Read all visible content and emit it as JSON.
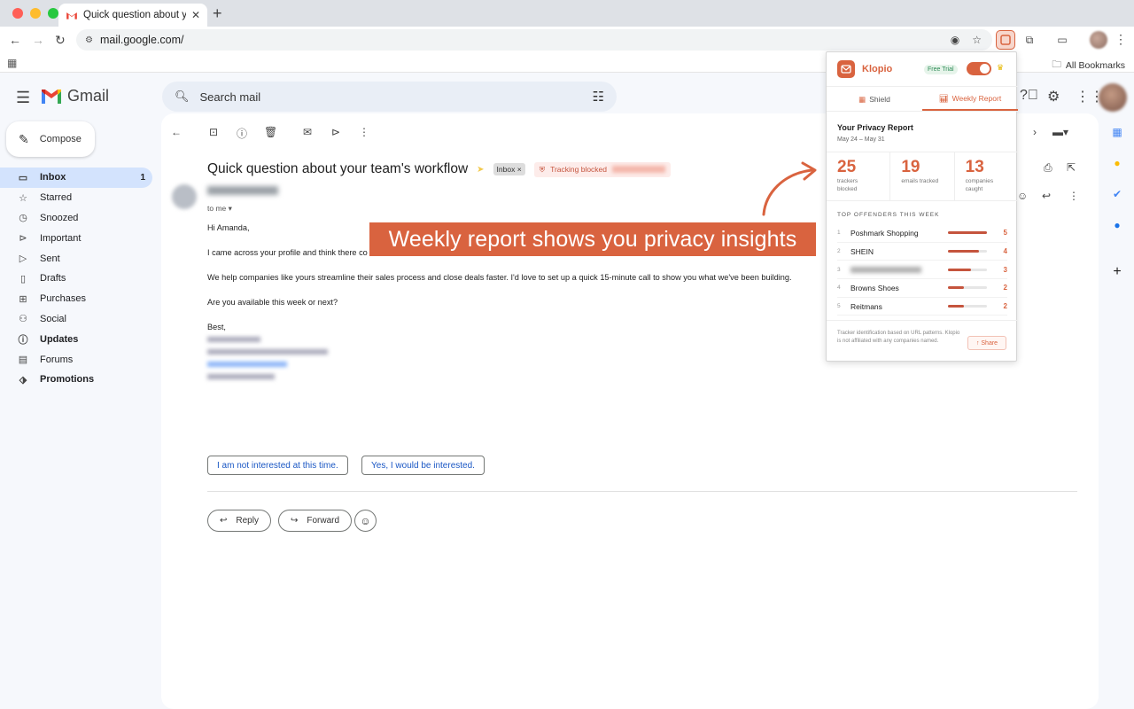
{
  "browser": {
    "tab_title": "Quick question about your team's workflow",
    "url": "mail.google.com/",
    "all_bookmarks": "All Bookmarks",
    "traffic_lights": [
      "#ff5f57",
      "#febc2e",
      "#28c840"
    ]
  },
  "gmail": {
    "brand": "Gmail",
    "search_placeholder": "Search mail",
    "compose": "Compose",
    "nav": [
      {
        "label": "Inbox",
        "icon": "inbox-icon",
        "count": "1",
        "active": true
      },
      {
        "label": "Starred",
        "icon": "star-icon"
      },
      {
        "label": "Snoozed",
        "icon": "clock-icon"
      },
      {
        "label": "Important",
        "icon": "important-icon"
      },
      {
        "label": "Sent",
        "icon": "send-icon"
      },
      {
        "label": "Drafts",
        "icon": "draft-icon"
      },
      {
        "label": "Purchases",
        "icon": "purchases-icon"
      },
      {
        "label": "Social",
        "icon": "social-icon"
      },
      {
        "label": "Updates",
        "icon": "updates-icon",
        "bold": true
      },
      {
        "label": "Forums",
        "icon": "forums-icon"
      },
      {
        "label": "Promotions",
        "icon": "promotions-icon",
        "bold": true
      }
    ]
  },
  "email": {
    "subject": "Quick question about your team's workflow",
    "label": "Inbox",
    "label_close": "×",
    "tracking": "Tracking blocked",
    "to": "to me",
    "greeting": "Hi Amanda,",
    "para1": "I came across your profile and think there co",
    "para2": "We help companies like yours streamline their sales process and close deals faster. I'd love to set up a quick 15-minute call to show you what we've been building.",
    "para3": "Are you available this week or next?",
    "signoff": "Best,",
    "smart_replies": [
      "I am not interested at this time.",
      "Yes, I would be interested."
    ],
    "reply": "Reply",
    "forward": "Forward"
  },
  "annotation": {
    "banner": "Weekly report shows you privacy insights",
    "accent": "#d9633f"
  },
  "klopio": {
    "name": "Klopio",
    "trial": "Free Trial",
    "toggle_on": true,
    "tabs": [
      "Shield",
      "Weekly Report"
    ],
    "active_tab": "Weekly Report",
    "report_title": "Your Privacy Report",
    "report_dates": "May 24 – May 31",
    "stats": [
      {
        "value": "25",
        "label": "trackers blocked"
      },
      {
        "value": "19",
        "label": "emails tracked"
      },
      {
        "value": "13",
        "label": "companies caught"
      }
    ],
    "offenders_title": "TOP OFFENDERS THIS WEEK",
    "offenders": [
      {
        "rank": "1",
        "name": "Poshmark Shopping",
        "count": "5",
        "fraction": 1.0
      },
      {
        "rank": "2",
        "name": "SHEIN",
        "count": "4",
        "fraction": 0.8
      },
      {
        "rank": "3",
        "name": "",
        "count": "3",
        "fraction": 0.6,
        "blurred": true
      },
      {
        "rank": "4",
        "name": "Browns Shoes",
        "count": "2",
        "fraction": 0.4
      },
      {
        "rank": "5",
        "name": "Reitmans",
        "count": "2",
        "fraction": 0.4
      }
    ],
    "footnote": "Tracker identification based on URL patterns. Klopio is not affiliated with any companies named.",
    "share": "↑ Share"
  }
}
